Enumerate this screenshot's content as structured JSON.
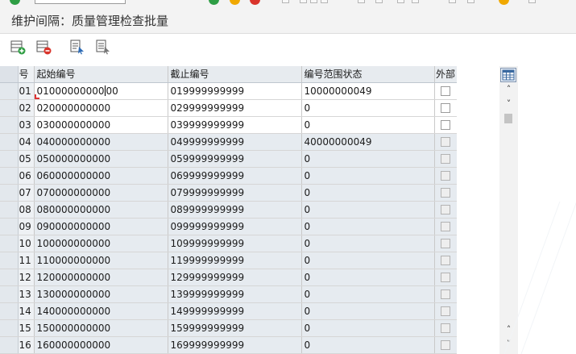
{
  "page": {
    "title": "维护间隔：质量管理检查批量"
  },
  "toolbar": {
    "buttons": [
      {
        "name": "insert-row-button",
        "icon": "table-insert-icon",
        "color": "#2f9e44"
      },
      {
        "name": "delete-row-button",
        "icon": "table-delete-icon",
        "color": "#d9342b"
      },
      {
        "name": "detail-button",
        "icon": "document-pointer-icon"
      },
      {
        "name": "print-button",
        "icon": "document-list-icon"
      }
    ]
  },
  "table": {
    "headers": {
      "no": "号",
      "from": "起始编号",
      "to": "截止编号",
      "status": "编号范围状态",
      "external": "外部"
    },
    "rows": [
      {
        "no": "01",
        "from_before": "01000000000",
        "from_after": "00",
        "to": "019999999999",
        "status": "10000000049",
        "external": false,
        "shaded": false
      },
      {
        "no": "02",
        "from": "020000000000",
        "to": "029999999999",
        "status": "0",
        "external": false,
        "shaded": false
      },
      {
        "no": "03",
        "from": "030000000000",
        "to": "039999999999",
        "status": "0",
        "external": false,
        "shaded": false
      },
      {
        "no": "04",
        "from": "040000000000",
        "to": "049999999999",
        "status": "40000000049",
        "external": false,
        "shaded": true
      },
      {
        "no": "05",
        "from": "050000000000",
        "to": "059999999999",
        "status": "0",
        "external": false,
        "shaded": true
      },
      {
        "no": "06",
        "from": "060000000000",
        "to": "069999999999",
        "status": "0",
        "external": false,
        "shaded": true
      },
      {
        "no": "07",
        "from": "070000000000",
        "to": "079999999999",
        "status": "0",
        "external": false,
        "shaded": true
      },
      {
        "no": "08",
        "from": "080000000000",
        "to": "089999999999",
        "status": "0",
        "external": false,
        "shaded": true
      },
      {
        "no": "09",
        "from": "090000000000",
        "to": "099999999999",
        "status": "0",
        "external": false,
        "shaded": true
      },
      {
        "no": "10",
        "from": "100000000000",
        "to": "109999999999",
        "status": "0",
        "external": false,
        "shaded": true
      },
      {
        "no": "11",
        "from": "110000000000",
        "to": "119999999999",
        "status": "0",
        "external": false,
        "shaded": true
      },
      {
        "no": "12",
        "from": "120000000000",
        "to": "129999999999",
        "status": "0",
        "external": false,
        "shaded": true
      },
      {
        "no": "13",
        "from": "130000000000",
        "to": "139999999999",
        "status": "0",
        "external": false,
        "shaded": true
      },
      {
        "no": "14",
        "from": "140000000000",
        "to": "149999999999",
        "status": "0",
        "external": false,
        "shaded": true
      },
      {
        "no": "15",
        "from": "150000000000",
        "to": "159999999999",
        "status": "0",
        "external": false,
        "shaded": true
      },
      {
        "no": "16",
        "from": "160000000000",
        "to": "169999999999",
        "status": "0",
        "external": false,
        "shaded": true
      }
    ]
  },
  "scrollbar": {
    "up_glyph": "˄",
    "down_glyph": "˅",
    "settings_icon": "grid-settings-icon"
  }
}
